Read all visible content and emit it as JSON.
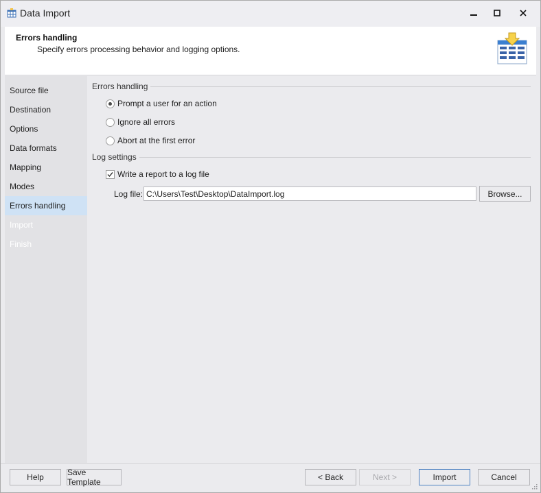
{
  "window": {
    "title": "Data Import"
  },
  "header": {
    "title": "Errors handling",
    "subtitle": "Specify errors processing behavior and logging options."
  },
  "sidebar": {
    "items": [
      {
        "label": "Source file",
        "state": "normal"
      },
      {
        "label": "Destination",
        "state": "normal"
      },
      {
        "label": "Options",
        "state": "normal"
      },
      {
        "label": "Data formats",
        "state": "normal"
      },
      {
        "label": "Mapping",
        "state": "normal"
      },
      {
        "label": "Modes",
        "state": "normal"
      },
      {
        "label": "Errors handling",
        "state": "active"
      },
      {
        "label": "Import",
        "state": "disabled"
      },
      {
        "label": "Finish",
        "state": "disabled"
      }
    ]
  },
  "errors_group": {
    "title": "Errors handling",
    "options": [
      {
        "label": "Prompt a user for an action",
        "checked": true
      },
      {
        "label": "Ignore all errors",
        "checked": false
      },
      {
        "label": "Abort at the first error",
        "checked": false
      }
    ]
  },
  "log_group": {
    "title": "Log settings",
    "write_report_label": "Write a report to a log file",
    "write_report_checked": true,
    "log_file_label": "Log file:",
    "log_file_value": "C:\\Users\\Test\\Desktop\\DataImport.log",
    "browse_label": "Browse..."
  },
  "footer": {
    "help": "Help",
    "save_template": "Save Template",
    "back": "< Back",
    "next": "Next >",
    "import": "Import",
    "cancel": "Cancel"
  },
  "colors": {
    "accent": "#4a7fc1",
    "active_item": "#cfe2f5",
    "sidebar_bg": "#e2e2e5",
    "window_bg": "#ebebee"
  },
  "icons": {
    "app": "table-grid-icon",
    "header": "table-import-icon"
  }
}
